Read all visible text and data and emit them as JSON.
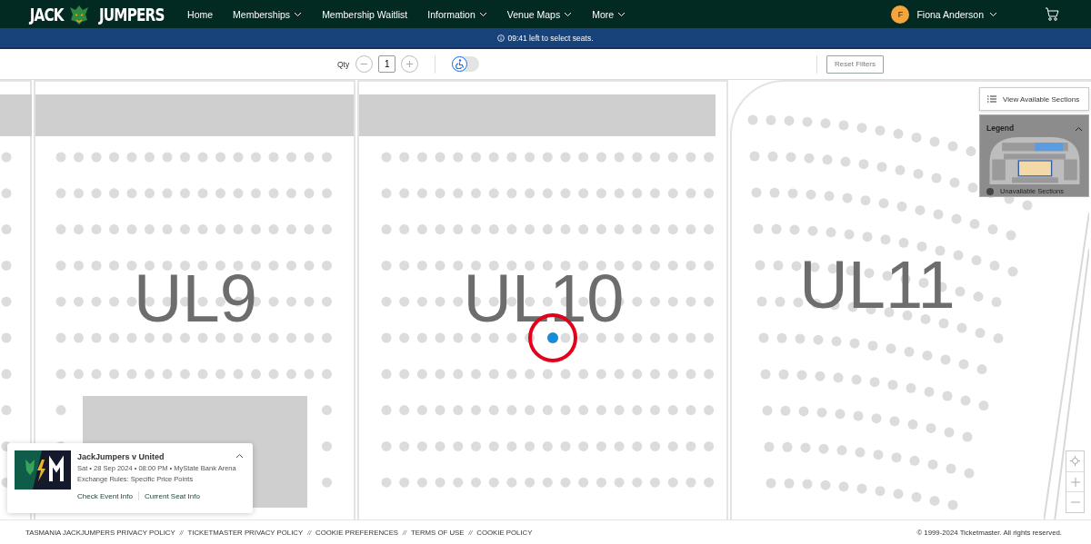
{
  "header": {
    "logo": {
      "left": "JACK",
      "right": "JUMPERS"
    },
    "nav": [
      {
        "label": "Home",
        "dropdown": false
      },
      {
        "label": "Memberships",
        "dropdown": true
      },
      {
        "label": "Membership Waitlist",
        "dropdown": false
      },
      {
        "label": "Information",
        "dropdown": true
      },
      {
        "label": "Venue Maps",
        "dropdown": true
      },
      {
        "label": "More",
        "dropdown": true
      }
    ],
    "user": {
      "initial": "F",
      "name": "Fiona Anderson"
    }
  },
  "timer_bar": {
    "text": "09:41 left to select seats."
  },
  "toolbar": {
    "qty_label": "Qty",
    "qty_value": "1",
    "accessible_only": false,
    "reset_button": "Reset Filters"
  },
  "map": {
    "sections": [
      {
        "label": "UL9"
      },
      {
        "label": "UL10"
      },
      {
        "label": "UL11"
      }
    ],
    "view_sections_button": "View Available Sections",
    "legend": {
      "title": "Legend",
      "expanded": true,
      "items": [
        "Unavailable Sections"
      ]
    }
  },
  "event_card": {
    "title": "JackJumpers v United",
    "details": "Sat • 28 Sep 2024 • 08:00 PM • MyState Bank Arena",
    "rules": "Exchange Rules: Specific Price Points",
    "links": [
      "Check Event Info",
      "Current Seat Info"
    ]
  },
  "footer": {
    "links": [
      "TASMANIA JACKJUMPERS PRIVACY POLICY",
      "TICKETMASTER PRIVACY POLICY",
      "COOKIE PREFERENCES",
      "TERMS OF USE",
      "COOKIE POLICY"
    ],
    "separator": "//",
    "copyright": "© 1999-2024 Ticketmaster. All rights reserved."
  }
}
